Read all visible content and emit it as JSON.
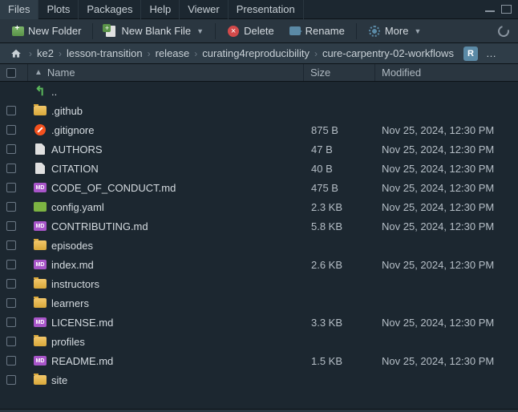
{
  "tabs": [
    "Files",
    "Plots",
    "Packages",
    "Help",
    "Viewer",
    "Presentation"
  ],
  "active_tab": 0,
  "toolbar": {
    "new_folder": "New Folder",
    "new_file": "New Blank File",
    "delete": "Delete",
    "rename": "Rename",
    "more": "More"
  },
  "breadcrumbs": {
    "items": [
      "ke2",
      "lesson-transition",
      "release",
      "curating4reproducibility",
      "cure-carpentry-02-workflows"
    ],
    "badge": "R"
  },
  "header": {
    "name": "Name",
    "size": "Size",
    "modified": "Modified"
  },
  "up_label": "..",
  "rows": [
    {
      "kind": "folder",
      "name": ".github",
      "size": "",
      "modified": ""
    },
    {
      "kind": "git",
      "name": ".gitignore",
      "size": "875 B",
      "modified": "Nov 25, 2024, 12:30 PM"
    },
    {
      "kind": "file",
      "name": "AUTHORS",
      "size": "47 B",
      "modified": "Nov 25, 2024, 12:30 PM"
    },
    {
      "kind": "file",
      "name": "CITATION",
      "size": "40 B",
      "modified": "Nov 25, 2024, 12:30 PM"
    },
    {
      "kind": "md",
      "name": "CODE_OF_CONDUCT.md",
      "size": "475 B",
      "modified": "Nov 25, 2024, 12:30 PM"
    },
    {
      "kind": "yaml",
      "name": "config.yaml",
      "size": "2.3 KB",
      "modified": "Nov 25, 2024, 12:30 PM"
    },
    {
      "kind": "md",
      "name": "CONTRIBUTING.md",
      "size": "5.8 KB",
      "modified": "Nov 25, 2024, 12:30 PM"
    },
    {
      "kind": "folder",
      "name": "episodes",
      "size": "",
      "modified": ""
    },
    {
      "kind": "md",
      "name": "index.md",
      "size": "2.6 KB",
      "modified": "Nov 25, 2024, 12:30 PM"
    },
    {
      "kind": "folder",
      "name": "instructors",
      "size": "",
      "modified": ""
    },
    {
      "kind": "folder",
      "name": "learners",
      "size": "",
      "modified": ""
    },
    {
      "kind": "md",
      "name": "LICENSE.md",
      "size": "3.3 KB",
      "modified": "Nov 25, 2024, 12:30 PM"
    },
    {
      "kind": "folder",
      "name": "profiles",
      "size": "",
      "modified": ""
    },
    {
      "kind": "md",
      "name": "README.md",
      "size": "1.5 KB",
      "modified": "Nov 25, 2024, 12:30 PM"
    },
    {
      "kind": "folder",
      "name": "site",
      "size": "",
      "modified": ""
    }
  ]
}
